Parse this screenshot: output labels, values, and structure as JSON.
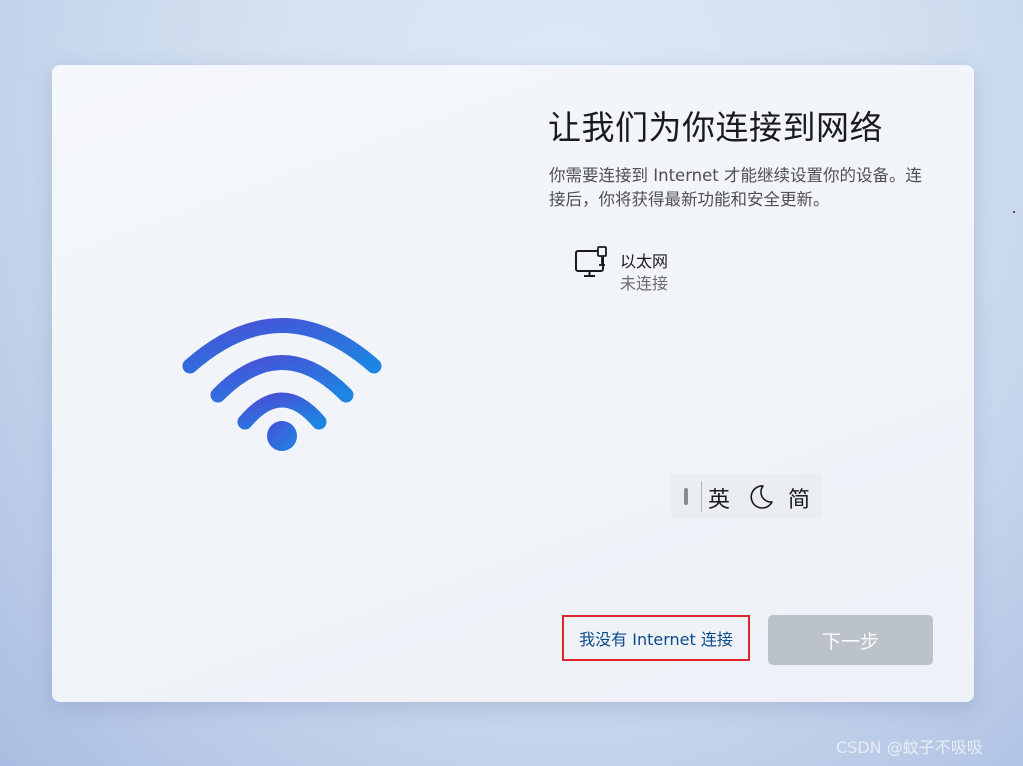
{
  "oobe": {
    "title": "让我们为你连接到网络",
    "description": "你需要连接到 Internet 才能继续设置你的设备。连接后，你将获得最新功能和安全更新。",
    "network": {
      "icon": "ethernet-computer-icon",
      "name": "以太网",
      "status": "未连接"
    },
    "hero_icon": "wifi-icon",
    "no_internet_label": "我没有 Internet 连接",
    "next_label": "下一步"
  },
  "ime": {
    "language": "英",
    "mode_icon": "moon-icon",
    "charset": "简"
  },
  "watermark": "CSDN @蚊子不吸吸",
  "colors": {
    "wifi_gradient_start": "#4355d8",
    "wifi_gradient_end": "#1e7fe0",
    "link": "#0b4a8c",
    "highlight_box": "#e0262b",
    "next_disabled": "#bcc2c9"
  }
}
